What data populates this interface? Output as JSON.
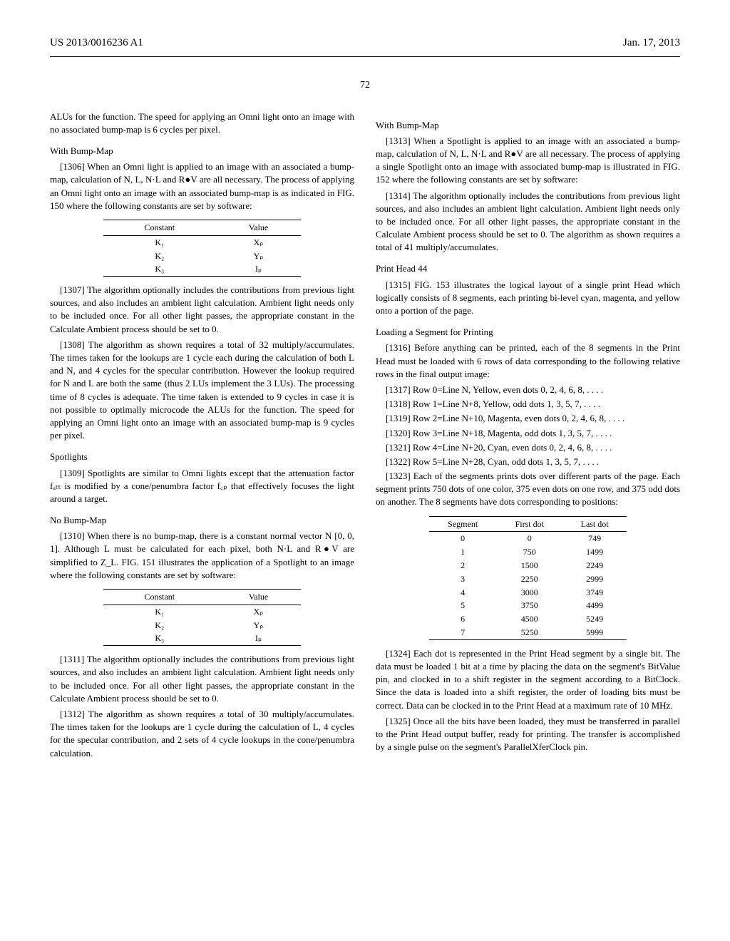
{
  "header": {
    "left": "US 2013/0016236 A1",
    "right": "Jan. 17, 2013"
  },
  "page_number": "72",
  "left_col": {
    "p1": "ALUs for the function. The speed for applying an Omni light onto an image with no associated bump-map is 6 cycles per pixel.",
    "s1": "With Bump-Map",
    "p2": "[1306]   When an Omni light is applied to an image with an associated a bump-map, calculation of N, L, N·L and R●V are all necessary. The process of applying an Omni light onto an image with an associated bump-map is as indicated in FIG. 150 where the following constants are set by software:",
    "table1": {
      "h1": "Constant",
      "h2": "Value",
      "r1c1": "K₁",
      "r1c2": "Xₚ",
      "r2c1": "K₂",
      "r2c2": "Yₚ",
      "r3c1": "K₃",
      "r3c2": "Iₚ"
    },
    "p3": "[1307]   The algorithm optionally includes the contributions from previous light sources, and also includes an ambient light calculation. Ambient light needs only to be included once. For all other light passes, the appropriate constant in the Calculate Ambient process should be set to 0.",
    "p4": "[1308]   The algorithm as shown requires a total of 32 multiply/accumulates. The times taken for the lookups are 1 cycle each during the calculation of both L and N, and 4 cycles for the specular contribution. However the lookup required for N and L are both the same (thus 2 LUs implement the 3 LUs). The processing time of 8 cycles is adequate. The time taken is extended to 9 cycles in case it is not possible to optimally microcode the ALUs for the function. The speed for applying an Omni light onto an image with an associated bump-map is 9 cycles per pixel.",
    "s2": "Spotlights",
    "p5": "[1309]   Spotlights are similar to Omni lights except that the attenuation factor fₐₜₜ is modified by a cone/penumbra factor f꜀ₚ that effectively focuses the light around a target.",
    "s3": "No Bump-Map",
    "p6": "[1310]   When there is no bump-map, there is a constant normal vector N [0, 0, 1]. Although L must be calculated for each pixel, both N·L and R●V are simplified to Z_L. FIG. 151 illustrates the application of a Spotlight to an image where the following constants are set by software:",
    "table2": {
      "h1": "Constant",
      "h2": "Value",
      "r1c1": "K₁",
      "r1c2": "Xₚ",
      "r2c1": "K₂",
      "r2c2": "Yₚ",
      "r3c1": "K₃",
      "r3c2": "Iₚ"
    },
    "p7": "[1311]   The algorithm optionally includes the contributions from previous light sources, and also includes an ambient light calculation. Ambient light needs only to be included once. For all other light passes, the appropriate constant in the Calculate Ambient process should be set to 0.",
    "p8": "[1312]   The algorithm as shown requires a total of 30 multiply/accumulates. The times taken for the lookups are 1 cycle during the calculation of L, 4 cycles for the specular contribution, and 2 sets of 4 cycle lookups in the cone/penumbra calculation."
  },
  "right_col": {
    "s1": "With Bump-Map",
    "p1": "[1313]   When a Spotlight is applied to an image with an associated a bump-map, calculation of N, L, N·L and R●V are all necessary. The process of applying a single Spotlight onto an image with associated bump-map is illustrated in FIG. 152 where the following constants are set by software:",
    "p2": "[1314]   The algorithm optionally includes the contributions from previous light sources, and also includes an ambient light calculation. Ambient light needs only to be included once. For all other light passes, the appropriate constant in the Calculate Ambient process should be set to 0. The algorithm as shown requires a total of 41 multiply/accumulates.",
    "s2": "Print Head 44",
    "p3": "[1315]   FIG. 153 illustrates the logical layout of a single print Head which logically consists of 8 segments, each printing bi-level cyan, magenta, and yellow onto a portion of the page.",
    "s3": "Loading a Segment for Printing",
    "p4": "[1316]   Before anything can be printed, each of the 8 segments in the Print Head must be loaded with 6 rows of data corresponding to the following relative rows in the final output image:",
    "row0": "[1317]   Row 0=Line N, Yellow, even dots 0, 2, 4, 6, 8, . . . .",
    "row1": "[1318]   Row 1=Line N+8, Yellow, odd dots 1, 3, 5, 7, . . . .",
    "row2": "[1319]   Row 2=Line N+10, Magenta, even dots 0, 2, 4, 6, 8, . . . .",
    "row3": "[1320]   Row 3=Line N+18, Magenta, odd dots 1, 3, 5, 7, . . . .",
    "row4": "[1321]   Row 4=Line N+20, Cyan, even dots 0, 2, 4, 6, 8, . . . .",
    "row5": "[1322]   Row 5=Line N+28, Cyan, odd dots 1, 3, 5, 7, . . . .",
    "p5": "[1323]   Each of the segments prints dots over different parts of the page. Each segment prints 750 dots of one color, 375 even dots on one row, and 375 odd dots on another. The 8 segments have dots corresponding to positions:",
    "table3": {
      "h1": "Segment",
      "h2": "First dot",
      "h3": "Last dot",
      "rows": [
        [
          "0",
          "0",
          "749"
        ],
        [
          "1",
          "750",
          "1499"
        ],
        [
          "2",
          "1500",
          "2249"
        ],
        [
          "3",
          "2250",
          "2999"
        ],
        [
          "4",
          "3000",
          "3749"
        ],
        [
          "5",
          "3750",
          "4499"
        ],
        [
          "6",
          "4500",
          "5249"
        ],
        [
          "7",
          "5250",
          "5999"
        ]
      ]
    },
    "p6": "[1324]   Each dot is represented in the Print Head segment by a single bit. The data must be loaded 1 bit at a time by placing the data on the segment's BitValue pin, and clocked in to a shift register in the segment according to a BitClock. Since the data is loaded into a shift register, the order of loading bits must be correct. Data can be clocked in to the Print Head at a maximum rate of 10 MHz.",
    "p7": "[1325]   Once all the bits have been loaded, they must be transferred in parallel to the Print Head output buffer, ready for printing. The transfer is accomplished by a single pulse on the segment's ParallelXferClock pin."
  },
  "chart_data": [
    {
      "type": "table",
      "title": "Omni light constants (with bump-map)",
      "columns": [
        "Constant",
        "Value"
      ],
      "rows": [
        [
          "K1",
          "X_P"
        ],
        [
          "K2",
          "Y_P"
        ],
        [
          "K3",
          "I_P"
        ]
      ]
    },
    {
      "type": "table",
      "title": "Spotlight constants (no bump-map)",
      "columns": [
        "Constant",
        "Value"
      ],
      "rows": [
        [
          "K1",
          "X_P"
        ],
        [
          "K2",
          "Y_P"
        ],
        [
          "K3",
          "I_P"
        ]
      ]
    },
    {
      "type": "table",
      "title": "Print head segment dot positions",
      "columns": [
        "Segment",
        "First dot",
        "Last dot"
      ],
      "rows": [
        [
          0,
          0,
          749
        ],
        [
          1,
          750,
          1499
        ],
        [
          2,
          1500,
          2249
        ],
        [
          3,
          2250,
          2999
        ],
        [
          4,
          3000,
          3749
        ],
        [
          5,
          3750,
          4499
        ],
        [
          6,
          4500,
          5249
        ],
        [
          7,
          5250,
          5999
        ]
      ]
    }
  ]
}
